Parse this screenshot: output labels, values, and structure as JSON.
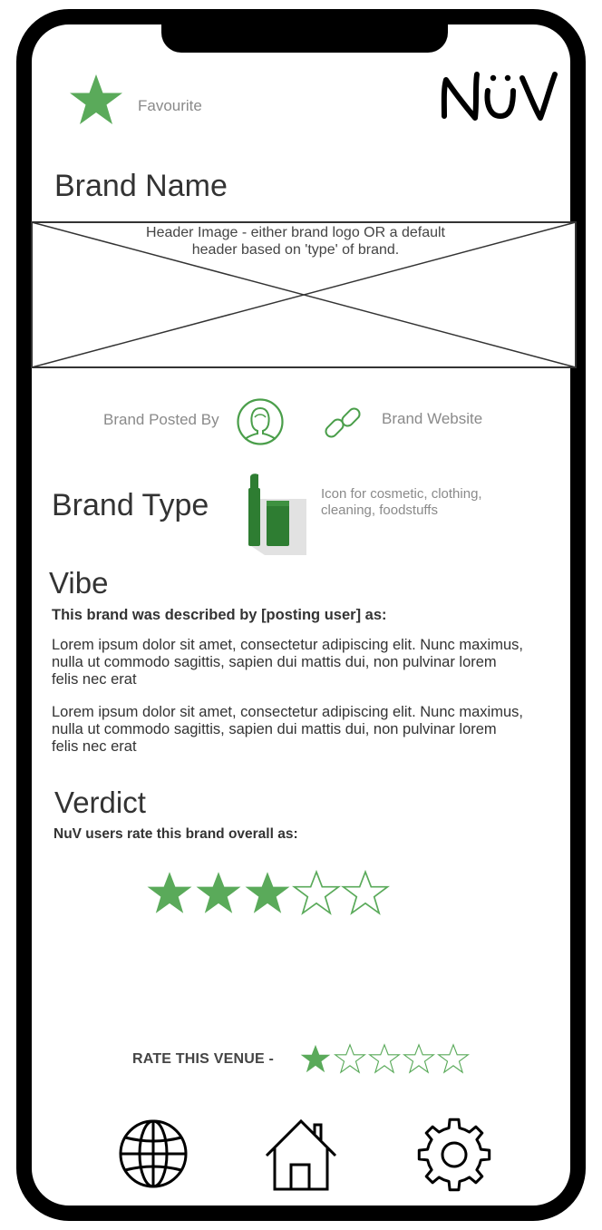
{
  "header": {
    "favourite_label": "Favourite",
    "logo_text": "NüV"
  },
  "brand": {
    "name": "Brand Name",
    "header_image_placeholder": "Header Image - either brand logo OR a default header based on 'type' of brand.",
    "posted_by_label": "Brand Posted By",
    "website_label": "Brand Website",
    "type_heading": "Brand Type",
    "type_icon_note": "Icon for cosmetic, clothing, cleaning, foodstuffs"
  },
  "vibe": {
    "heading": "Vibe",
    "subheading": "This brand was described by [posting user] as:",
    "paragraphs": [
      "Lorem ipsum dolor sit amet, consectetur adipiscing elit. Nunc maximus, nulla ut commodo sagittis, sapien dui mattis dui, non pulvinar lorem felis nec erat",
      "Lorem ipsum dolor sit amet, consectetur adipiscing elit. Nunc maximus, nulla ut commodo sagittis, sapien dui mattis dui, non pulvinar lorem felis nec erat"
    ]
  },
  "verdict": {
    "heading": "Verdict",
    "subheading": "NuV users rate this brand overall as:",
    "rating": 3,
    "max_rating": 5
  },
  "rate": {
    "label": "RATE THIS VENUE  -",
    "rating": 1,
    "max_rating": 5
  },
  "nav": {
    "icons": [
      "globe-icon",
      "home-icon",
      "settings-gear-icon"
    ]
  },
  "colors": {
    "accent_green": "#5aaa5a",
    "icon_green": "#2e7d32",
    "muted_text": "#8a8a8a"
  }
}
